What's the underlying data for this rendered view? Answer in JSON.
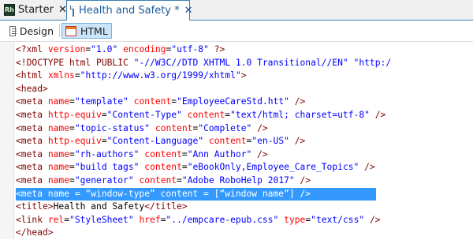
{
  "tabs": [
    {
      "icon": "rh-app-icon",
      "badge": "Rh",
      "label": "Starter",
      "close": "✕"
    },
    {
      "icon": "document-icon",
      "label": "Health and Safety *",
      "close": "✕",
      "active": true
    }
  ],
  "modes": {
    "design_label": "Design",
    "html_label": "HTML",
    "active": "HTML"
  },
  "code_lines": [
    [
      {
        "c": "tag",
        "t": "<?xml "
      },
      {
        "c": "attr",
        "t": "version"
      },
      {
        "c": "txt",
        "t": "="
      },
      {
        "c": "val",
        "t": "\"1.0\""
      },
      {
        "c": "txt",
        "t": " "
      },
      {
        "c": "attr",
        "t": "encoding"
      },
      {
        "c": "txt",
        "t": "="
      },
      {
        "c": "val",
        "t": "\"utf-8\""
      },
      {
        "c": "tag",
        "t": " ?>"
      }
    ],
    [
      {
        "c": "tag",
        "t": "<!DOCTYPE html PUBLIC "
      },
      {
        "c": "val",
        "t": "\"-//W3C//DTD XHTML 1.0 Transitional//EN\""
      },
      {
        "c": "txt",
        "t": " "
      },
      {
        "c": "val",
        "t": "\"http:/"
      }
    ],
    [
      {
        "c": "tag",
        "t": "<html "
      },
      {
        "c": "attr",
        "t": "xmlns"
      },
      {
        "c": "txt",
        "t": "="
      },
      {
        "c": "val",
        "t": "\"http://www.w3.org/1999/xhtml\""
      },
      {
        "c": "tag",
        "t": ">"
      }
    ],
    [
      {
        "c": "tag",
        "t": "<head>"
      }
    ],
    [
      {
        "c": "tag",
        "t": "<meta "
      },
      {
        "c": "attr",
        "t": "name"
      },
      {
        "c": "txt",
        "t": "="
      },
      {
        "c": "val",
        "t": "\"template\""
      },
      {
        "c": "txt",
        "t": " "
      },
      {
        "c": "attr",
        "t": "content"
      },
      {
        "c": "txt",
        "t": "="
      },
      {
        "c": "val",
        "t": "\"EmployeeCareStd.htt\""
      },
      {
        "c": "tag",
        "t": " />"
      }
    ],
    [
      {
        "c": "tag",
        "t": "<meta "
      },
      {
        "c": "attr",
        "t": "http-equiv"
      },
      {
        "c": "txt",
        "t": "="
      },
      {
        "c": "val",
        "t": "\"Content-Type\""
      },
      {
        "c": "txt",
        "t": " "
      },
      {
        "c": "attr",
        "t": "content"
      },
      {
        "c": "txt",
        "t": "="
      },
      {
        "c": "val",
        "t": "\"text/html; charset=utf-8\""
      },
      {
        "c": "tag",
        "t": " />"
      }
    ],
    [
      {
        "c": "tag",
        "t": "<meta "
      },
      {
        "c": "attr",
        "t": "name"
      },
      {
        "c": "txt",
        "t": "="
      },
      {
        "c": "val",
        "t": "\"topic-status\""
      },
      {
        "c": "txt",
        "t": " "
      },
      {
        "c": "attr",
        "t": "content"
      },
      {
        "c": "txt",
        "t": "="
      },
      {
        "c": "val",
        "t": "\"Complete\""
      },
      {
        "c": "tag",
        "t": " />"
      }
    ],
    [
      {
        "c": "tag",
        "t": "<meta "
      },
      {
        "c": "attr",
        "t": "http-equiv"
      },
      {
        "c": "txt",
        "t": "="
      },
      {
        "c": "val",
        "t": "\"Content-Language\""
      },
      {
        "c": "txt",
        "t": " "
      },
      {
        "c": "attr",
        "t": "content"
      },
      {
        "c": "txt",
        "t": "="
      },
      {
        "c": "val",
        "t": "\"en-US\""
      },
      {
        "c": "tag",
        "t": " />"
      }
    ],
    [
      {
        "c": "tag",
        "t": "<meta "
      },
      {
        "c": "attr",
        "t": "name"
      },
      {
        "c": "txt",
        "t": "="
      },
      {
        "c": "val",
        "t": "\"rh-authors\""
      },
      {
        "c": "txt",
        "t": " "
      },
      {
        "c": "attr",
        "t": "content"
      },
      {
        "c": "txt",
        "t": "="
      },
      {
        "c": "val",
        "t": "\"Ann Author\""
      },
      {
        "c": "tag",
        "t": " />"
      }
    ],
    [
      {
        "c": "tag",
        "t": "<meta "
      },
      {
        "c": "attr",
        "t": "name"
      },
      {
        "c": "txt",
        "t": "="
      },
      {
        "c": "val",
        "t": "\"build tags\""
      },
      {
        "c": "txt",
        "t": " "
      },
      {
        "c": "attr",
        "t": "content"
      },
      {
        "c": "txt",
        "t": "="
      },
      {
        "c": "val",
        "t": "\"eBookOnly,Employee_Care_Topics\""
      },
      {
        "c": "tag",
        "t": " />"
      }
    ],
    [
      {
        "c": "tag",
        "t": "<meta "
      },
      {
        "c": "attr",
        "t": "name"
      },
      {
        "c": "txt",
        "t": "="
      },
      {
        "c": "val",
        "t": "\"generator\""
      },
      {
        "c": "txt",
        "t": " "
      },
      {
        "c": "attr",
        "t": "content"
      },
      {
        "c": "txt",
        "t": "="
      },
      {
        "c": "val",
        "t": "\"Adobe RoboHelp 2017\""
      },
      {
        "c": "tag",
        "t": " />"
      }
    ],
    [
      {
        "c": "txt",
        "t": "<meta name = “window-type” content = [“window name”] />"
      }
    ],
    [
      {
        "c": "tag",
        "t": "<title>"
      },
      {
        "c": "txt",
        "t": "Health and Safety"
      },
      {
        "c": "tag",
        "t": "</title>"
      }
    ],
    [
      {
        "c": "tag",
        "t": "<link "
      },
      {
        "c": "attr",
        "t": "rel"
      },
      {
        "c": "txt",
        "t": "="
      },
      {
        "c": "val",
        "t": "\"StyleSheet\""
      },
      {
        "c": "txt",
        "t": " "
      },
      {
        "c": "attr",
        "t": "href"
      },
      {
        "c": "txt",
        "t": "="
      },
      {
        "c": "val",
        "t": "\"../empcare-epub.css\""
      },
      {
        "c": "txt",
        "t": " "
      },
      {
        "c": "attr",
        "t": "type"
      },
      {
        "c": "txt",
        "t": "="
      },
      {
        "c": "val",
        "t": "\"text/css\""
      },
      {
        "c": "tag",
        "t": " />"
      }
    ],
    [
      {
        "c": "tag",
        "t": "</head>"
      }
    ]
  ],
  "selected_line": 11,
  "colors": {
    "tag": "#800000",
    "attribute": "#ff0000",
    "value": "#0000ff",
    "selection": "#3399ff",
    "tab_accent": "#1e5aa0"
  }
}
